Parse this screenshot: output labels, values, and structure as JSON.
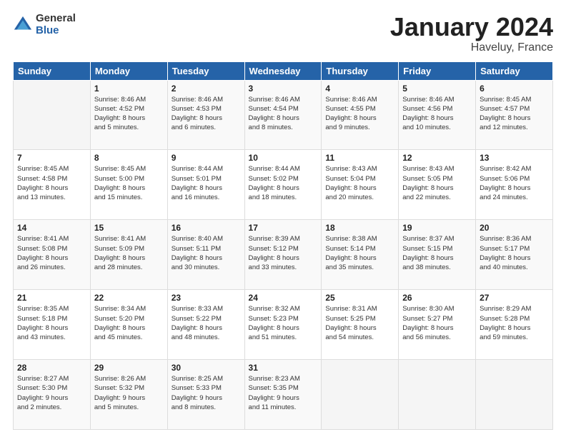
{
  "logo": {
    "general": "General",
    "blue": "Blue"
  },
  "title": "January 2024",
  "location": "Haveluy, France",
  "days_of_week": [
    "Sunday",
    "Monday",
    "Tuesday",
    "Wednesday",
    "Thursday",
    "Friday",
    "Saturday"
  ],
  "weeks": [
    [
      {
        "day": "",
        "info": ""
      },
      {
        "day": "1",
        "info": "Sunrise: 8:46 AM\nSunset: 4:52 PM\nDaylight: 8 hours\nand 5 minutes."
      },
      {
        "day": "2",
        "info": "Sunrise: 8:46 AM\nSunset: 4:53 PM\nDaylight: 8 hours\nand 6 minutes."
      },
      {
        "day": "3",
        "info": "Sunrise: 8:46 AM\nSunset: 4:54 PM\nDaylight: 8 hours\nand 8 minutes."
      },
      {
        "day": "4",
        "info": "Sunrise: 8:46 AM\nSunset: 4:55 PM\nDaylight: 8 hours\nand 9 minutes."
      },
      {
        "day": "5",
        "info": "Sunrise: 8:46 AM\nSunset: 4:56 PM\nDaylight: 8 hours\nand 10 minutes."
      },
      {
        "day": "6",
        "info": "Sunrise: 8:45 AM\nSunset: 4:57 PM\nDaylight: 8 hours\nand 12 minutes."
      }
    ],
    [
      {
        "day": "7",
        "info": "Sunrise: 8:45 AM\nSunset: 4:58 PM\nDaylight: 8 hours\nand 13 minutes."
      },
      {
        "day": "8",
        "info": "Sunrise: 8:45 AM\nSunset: 5:00 PM\nDaylight: 8 hours\nand 15 minutes."
      },
      {
        "day": "9",
        "info": "Sunrise: 8:44 AM\nSunset: 5:01 PM\nDaylight: 8 hours\nand 16 minutes."
      },
      {
        "day": "10",
        "info": "Sunrise: 8:44 AM\nSunset: 5:02 PM\nDaylight: 8 hours\nand 18 minutes."
      },
      {
        "day": "11",
        "info": "Sunrise: 8:43 AM\nSunset: 5:04 PM\nDaylight: 8 hours\nand 20 minutes."
      },
      {
        "day": "12",
        "info": "Sunrise: 8:43 AM\nSunset: 5:05 PM\nDaylight: 8 hours\nand 22 minutes."
      },
      {
        "day": "13",
        "info": "Sunrise: 8:42 AM\nSunset: 5:06 PM\nDaylight: 8 hours\nand 24 minutes."
      }
    ],
    [
      {
        "day": "14",
        "info": "Sunrise: 8:41 AM\nSunset: 5:08 PM\nDaylight: 8 hours\nand 26 minutes."
      },
      {
        "day": "15",
        "info": "Sunrise: 8:41 AM\nSunset: 5:09 PM\nDaylight: 8 hours\nand 28 minutes."
      },
      {
        "day": "16",
        "info": "Sunrise: 8:40 AM\nSunset: 5:11 PM\nDaylight: 8 hours\nand 30 minutes."
      },
      {
        "day": "17",
        "info": "Sunrise: 8:39 AM\nSunset: 5:12 PM\nDaylight: 8 hours\nand 33 minutes."
      },
      {
        "day": "18",
        "info": "Sunrise: 8:38 AM\nSunset: 5:14 PM\nDaylight: 8 hours\nand 35 minutes."
      },
      {
        "day": "19",
        "info": "Sunrise: 8:37 AM\nSunset: 5:15 PM\nDaylight: 8 hours\nand 38 minutes."
      },
      {
        "day": "20",
        "info": "Sunrise: 8:36 AM\nSunset: 5:17 PM\nDaylight: 8 hours\nand 40 minutes."
      }
    ],
    [
      {
        "day": "21",
        "info": "Sunrise: 8:35 AM\nSunset: 5:18 PM\nDaylight: 8 hours\nand 43 minutes."
      },
      {
        "day": "22",
        "info": "Sunrise: 8:34 AM\nSunset: 5:20 PM\nDaylight: 8 hours\nand 45 minutes."
      },
      {
        "day": "23",
        "info": "Sunrise: 8:33 AM\nSunset: 5:22 PM\nDaylight: 8 hours\nand 48 minutes."
      },
      {
        "day": "24",
        "info": "Sunrise: 8:32 AM\nSunset: 5:23 PM\nDaylight: 8 hours\nand 51 minutes."
      },
      {
        "day": "25",
        "info": "Sunrise: 8:31 AM\nSunset: 5:25 PM\nDaylight: 8 hours\nand 54 minutes."
      },
      {
        "day": "26",
        "info": "Sunrise: 8:30 AM\nSunset: 5:27 PM\nDaylight: 8 hours\nand 56 minutes."
      },
      {
        "day": "27",
        "info": "Sunrise: 8:29 AM\nSunset: 5:28 PM\nDaylight: 8 hours\nand 59 minutes."
      }
    ],
    [
      {
        "day": "28",
        "info": "Sunrise: 8:27 AM\nSunset: 5:30 PM\nDaylight: 9 hours\nand 2 minutes."
      },
      {
        "day": "29",
        "info": "Sunrise: 8:26 AM\nSunset: 5:32 PM\nDaylight: 9 hours\nand 5 minutes."
      },
      {
        "day": "30",
        "info": "Sunrise: 8:25 AM\nSunset: 5:33 PM\nDaylight: 9 hours\nand 8 minutes."
      },
      {
        "day": "31",
        "info": "Sunrise: 8:23 AM\nSunset: 5:35 PM\nDaylight: 9 hours\nand 11 minutes."
      },
      {
        "day": "",
        "info": ""
      },
      {
        "day": "",
        "info": ""
      },
      {
        "day": "",
        "info": ""
      }
    ]
  ]
}
